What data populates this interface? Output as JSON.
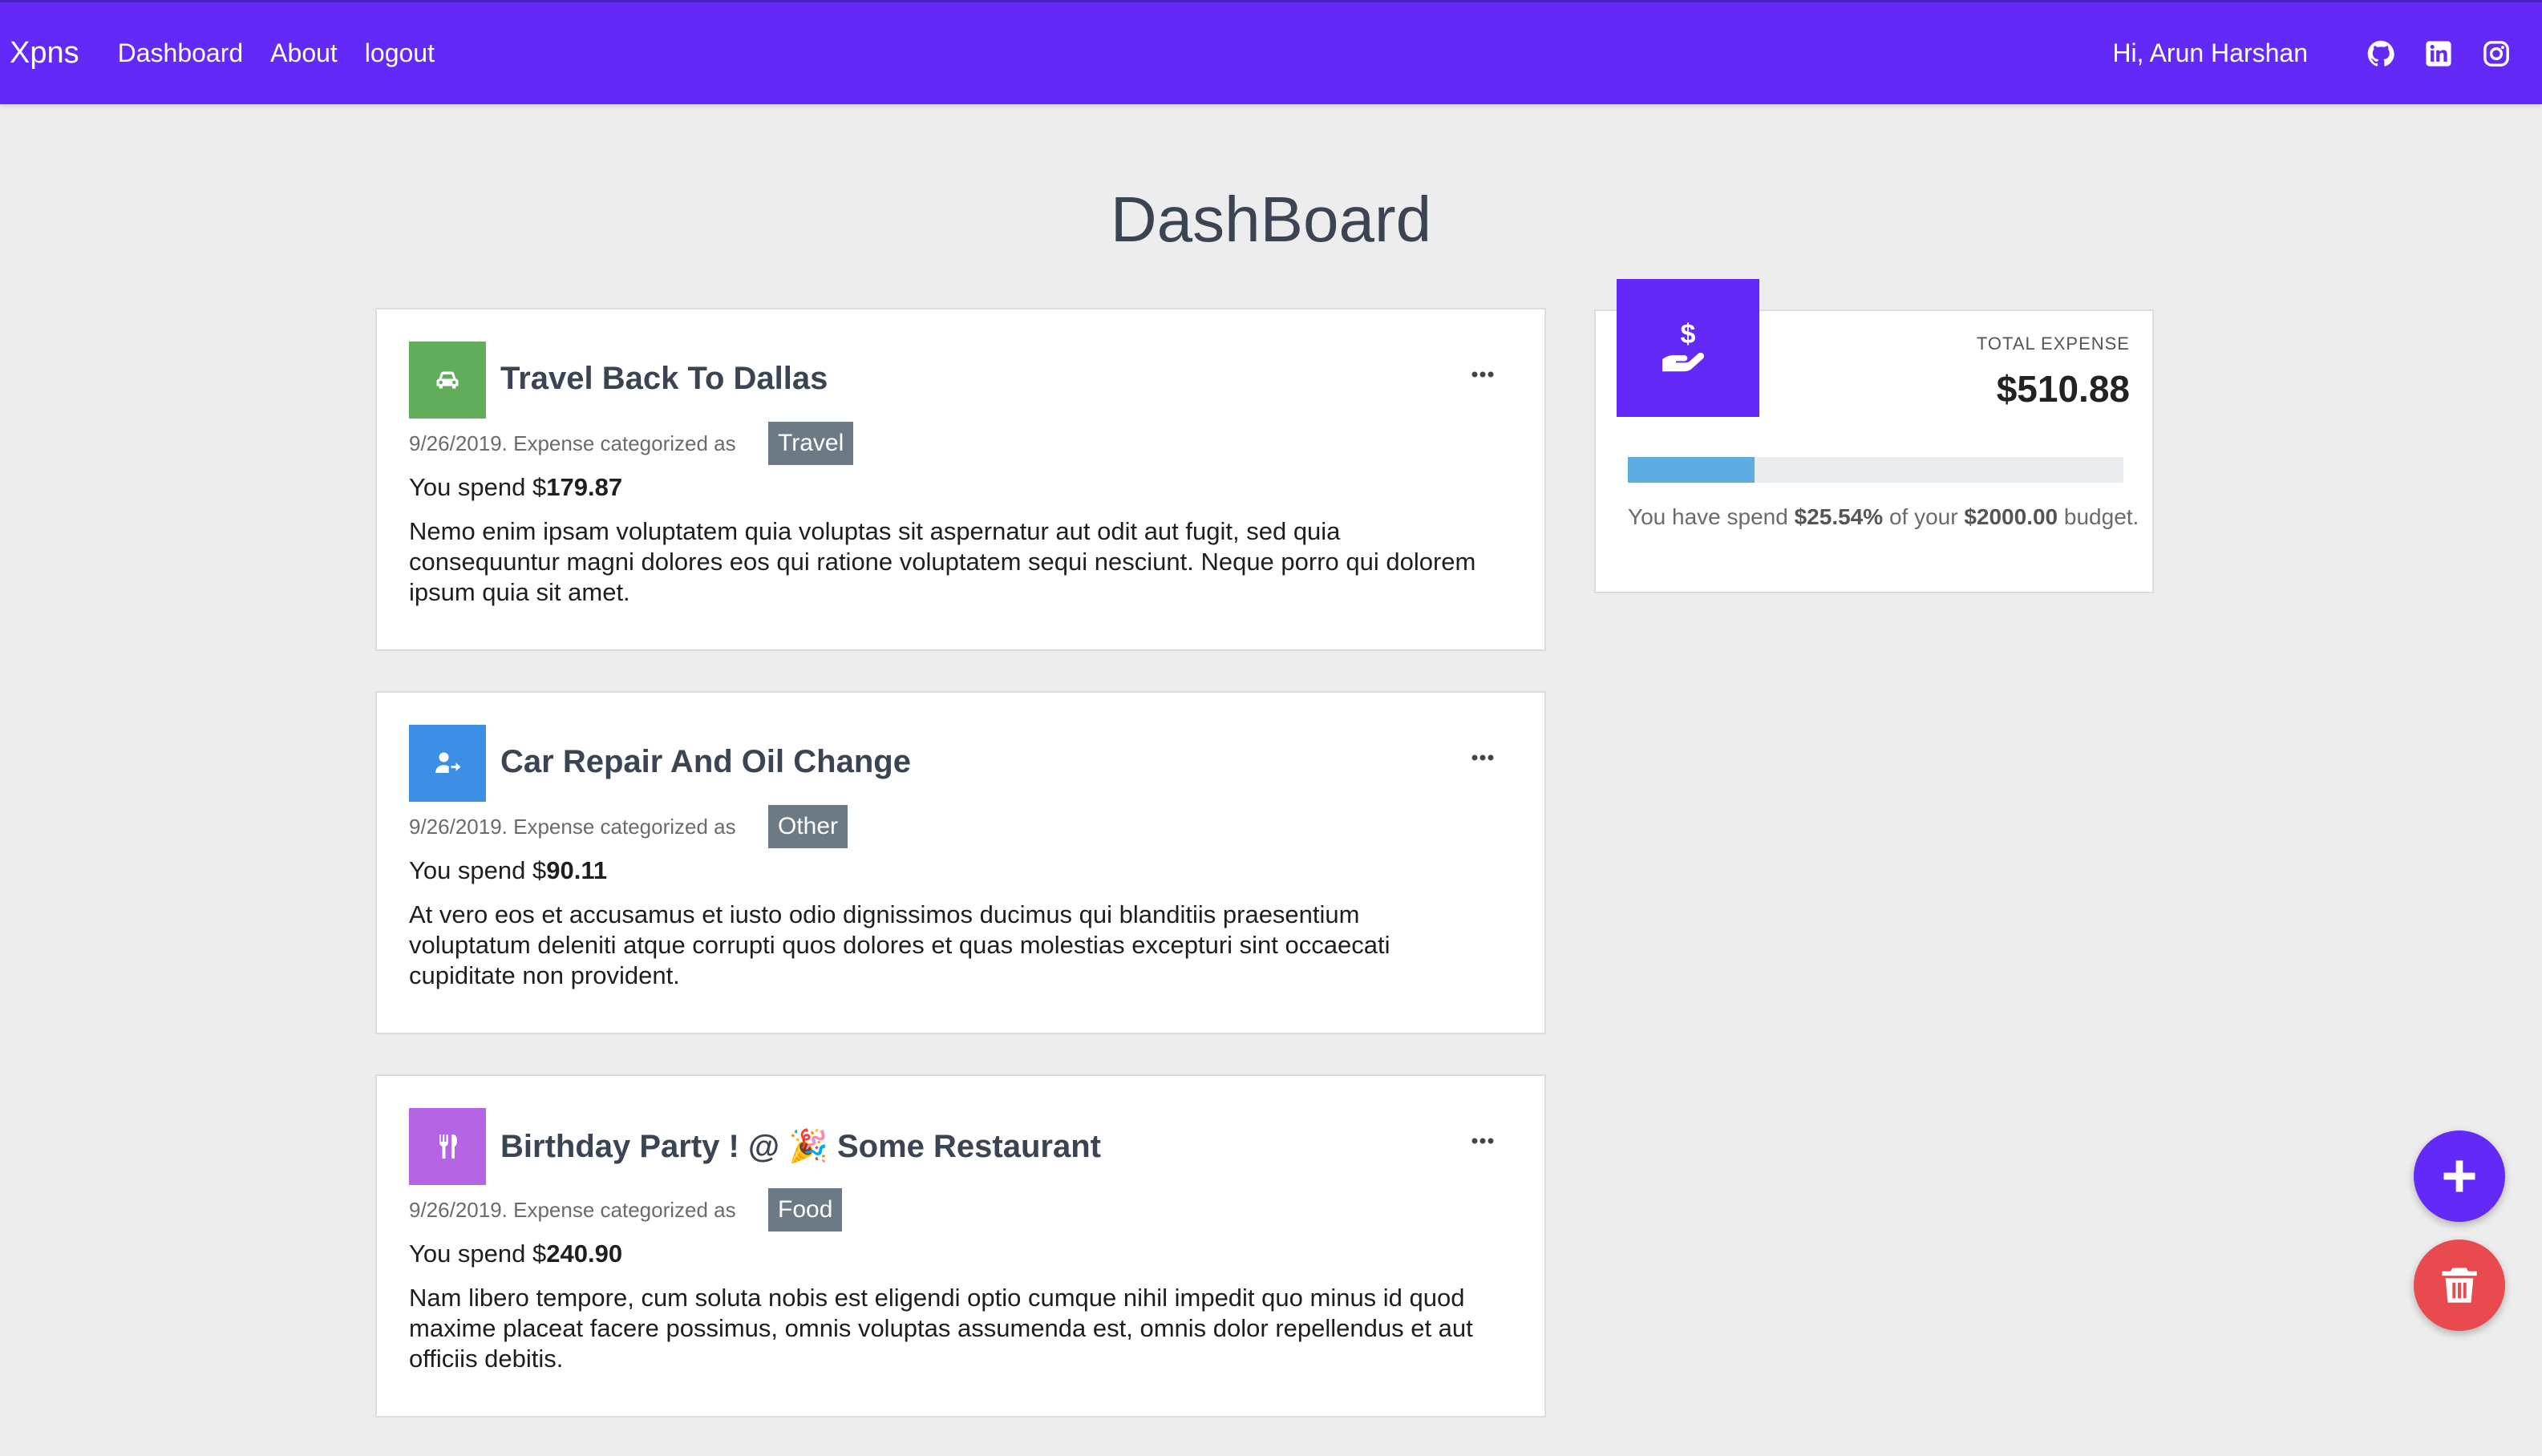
{
  "navbar": {
    "brand": "Xpns",
    "links": [
      "Dashboard",
      "About",
      "logout"
    ],
    "greeting": "Hi, Arun Harshan",
    "social_icons": [
      "github-icon",
      "linkedin-icon",
      "instagram-icon"
    ]
  },
  "page_title": "DashBoard",
  "expenses": [
    {
      "title": "Travel Back To Dallas",
      "icon": "car-icon",
      "icon_color": "#62ad5c",
      "meta": "9/26/2019. Expense categorized as",
      "category": "Travel",
      "spend_prefix": "You spend $",
      "amount": "179.87",
      "description": "Nemo enim ipsam voluptatem quia voluptas sit aspernatur aut odit aut fugit, sed quia consequuntur magni dolores eos qui ratione voluptatem sequi nesciunt. Neque porro qui dolorem ipsum quia sit amet."
    },
    {
      "title": "Car Repair And Oil Change",
      "icon": "user-arrow-icon",
      "icon_color": "#3d8fe6",
      "meta": "9/26/2019. Expense categorized as",
      "category": "Other",
      "spend_prefix": "You spend $",
      "amount": "90.11",
      "description": "At vero eos et accusamus et iusto odio dignissimos ducimus qui blanditiis praesentium voluptatum deleniti atque corrupti quos dolores et quas molestias excepturi sint occaecati cupiditate non provident."
    },
    {
      "title": "Birthday Party ! @ 🎉 Some Restaurant",
      "icon": "utensils-icon",
      "icon_color": "#b565e3",
      "meta": "9/26/2019. Expense categorized as",
      "category": "Food",
      "spend_prefix": "You spend $",
      "amount": "240.90",
      "description": "Nam libero tempore, cum soluta nobis est eligendi optio cumque nihil impedit quo minus id quod maxime placeat facere possimus, omnis voluptas assumenda est, omnis dolor repellendus et aut officiis debitis."
    }
  ],
  "summary": {
    "icon": "hand-dollar-icon",
    "label": "TOTAL EXPENSE",
    "total": "$510.88",
    "progress_percent": 25.54,
    "budget_prefix": "You have spend",
    "percent_text": "$25.54%",
    "budget_mid": "of your",
    "budget_amount": "$2000.00",
    "budget_suffix": "budget."
  },
  "fabs": {
    "add": {
      "icon": "plus-icon",
      "color": "#6329f6"
    },
    "delete": {
      "icon": "trash-icon",
      "color": "#e84a4f"
    }
  },
  "colors": {
    "primary": "#6329f6",
    "tag": "#6c7a85",
    "progress": "#5dade2"
  }
}
